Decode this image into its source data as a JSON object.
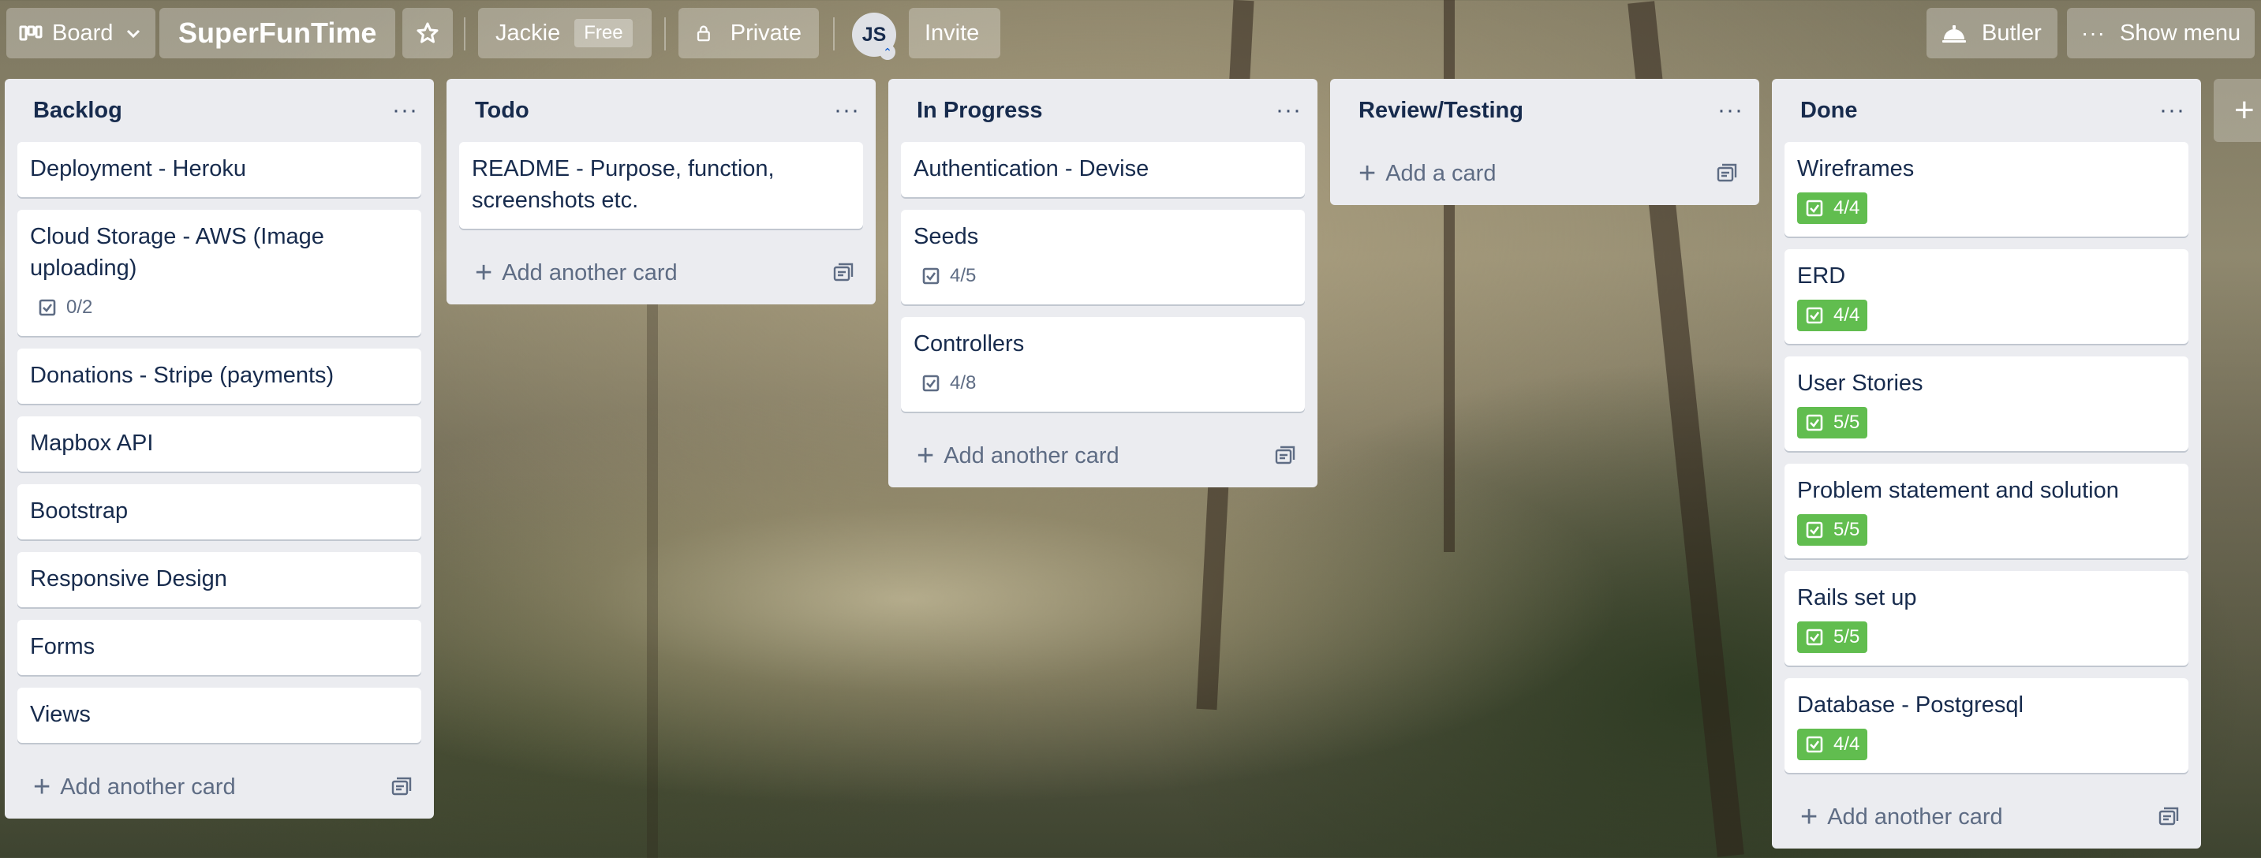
{
  "header": {
    "board_switcher_label": "Board",
    "board_name": "SuperFunTime",
    "workspace_name": "Jackie",
    "plan_badge": "Free",
    "visibility_label": "Private",
    "avatar_initials": "JS",
    "invite_label": "Invite",
    "butler_label": "Butler",
    "show_menu_label": "Show menu"
  },
  "icons": {
    "board": "board-icon",
    "chevron": "chevron-down-icon",
    "star": "star-icon",
    "lock": "lock-icon",
    "butler": "butler-bell-icon",
    "menu": "more-dots-icon",
    "checklist": "checklist-icon",
    "template": "card-template-icon"
  },
  "colors": {
    "list_bg": "#ebecf0",
    "checklist_complete": "#61bd4f",
    "text_primary": "#172b4d",
    "text_muted": "#5e6c84"
  },
  "lists": [
    {
      "title": "Backlog",
      "menu": "···",
      "cards": [
        {
          "title": "Deployment - Heroku"
        },
        {
          "title": "Cloud Storage - AWS (Image uploading)",
          "checklist": "0/2"
        },
        {
          "title": "Donations - Stripe (payments)"
        },
        {
          "title": "Mapbox API"
        },
        {
          "title": "Bootstrap"
        },
        {
          "title": "Responsive Design"
        },
        {
          "title": "Forms"
        },
        {
          "title": "Views"
        }
      ],
      "add_label": "Add another card"
    },
    {
      "title": "Todo",
      "menu": "···",
      "cards": [
        {
          "title": "README - Purpose, function, screenshots etc."
        }
      ],
      "add_label": "Add another card"
    },
    {
      "title": "In Progress",
      "menu": "···",
      "cards": [
        {
          "title": "Authentication - Devise"
        },
        {
          "title": "Seeds",
          "checklist": "4/5"
        },
        {
          "title": "Controllers",
          "checklist": "4/8"
        }
      ],
      "add_label": "Add another card"
    },
    {
      "title": "Review/Testing",
      "menu": "···",
      "cards": [],
      "add_label": "Add a card"
    },
    {
      "title": "Done",
      "menu": "···",
      "cards": [
        {
          "title": "Wireframes",
          "checklist": "4/4",
          "complete": true
        },
        {
          "title": "ERD",
          "checklist": "4/4",
          "complete": true
        },
        {
          "title": "User Stories",
          "checklist": "5/5",
          "complete": true
        },
        {
          "title": "Problem statement and solution",
          "checklist": "5/5",
          "complete": true
        },
        {
          "title": "Rails set up",
          "checklist": "5/5",
          "complete": true
        },
        {
          "title": "Database - Postgresql",
          "checklist": "4/4",
          "complete": true
        }
      ],
      "add_label": "Add another card"
    }
  ],
  "add_list_symbol": "+"
}
